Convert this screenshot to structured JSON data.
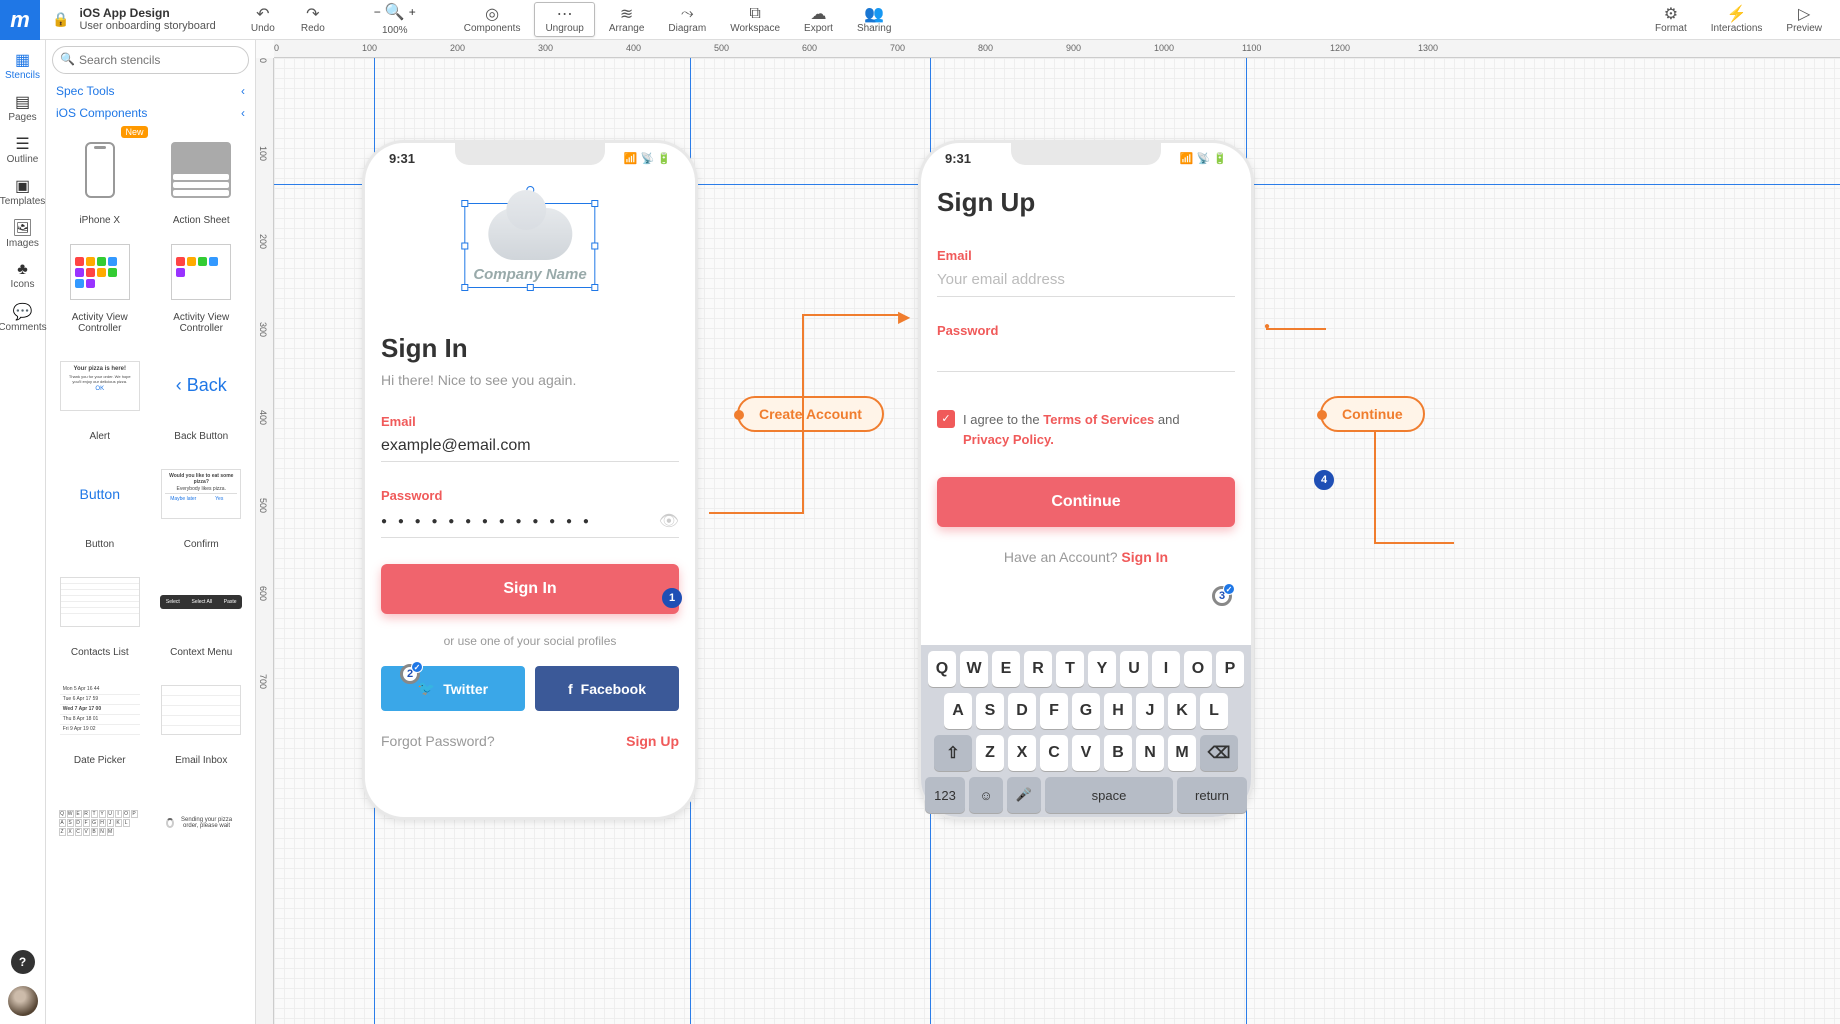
{
  "doc": {
    "title": "iOS App Design",
    "subtitle": "User onboarding storyboard"
  },
  "toolbar": {
    "undo": "Undo",
    "redo": "Redo",
    "zoom": "100%",
    "components": "Components",
    "ungroup": "Ungroup",
    "arrange": "Arrange",
    "diagram": "Diagram",
    "workspace": "Workspace",
    "export": "Export",
    "sharing": "Sharing",
    "format": "Format",
    "interactions": "Interactions",
    "preview": "Preview"
  },
  "leftrail": {
    "stencils": "Stencils",
    "pages": "Pages",
    "outline": "Outline",
    "templates": "Templates",
    "images": "Images",
    "icons": "Icons",
    "comments": "Comments"
  },
  "search": {
    "placeholder": "Search stencils"
  },
  "categories": {
    "spec": "Spec Tools",
    "ios": "iOS Components"
  },
  "stencils": [
    {
      "label": "iPhone X",
      "new": true
    },
    {
      "label": "Action Sheet"
    },
    {
      "label": "Activity View Controller"
    },
    {
      "label": "Activity View Controller"
    },
    {
      "label": "Alert",
      "alert_title": "Your pizza is here!",
      "alert_body": "Thank you for your order. We hope you'll enjoy our delicious pizza.",
      "alert_ok": "OK"
    },
    {
      "label": "Back Button",
      "text": "Back"
    },
    {
      "label": "Button",
      "text": "Button"
    },
    {
      "label": "Confirm",
      "q": "Would you like to eat some pizza?",
      "sub": "Everybody likes pizza.",
      "left": "Maybe later",
      "right": "Yes"
    },
    {
      "label": "Contacts List"
    },
    {
      "label": "Context Menu",
      "items": [
        "Select",
        "Select All",
        "Paste"
      ]
    },
    {
      "label": "Date Picker",
      "rows": [
        "Mon 5 Apr  16  44",
        "Tue 6 Apr  17  59",
        "Wed 7 Apr  17  00",
        "Thu 8 Apr  18  01",
        "Fri 9 Apr  19  02"
      ]
    },
    {
      "label": "Email Inbox"
    },
    {
      "label": "",
      "kb_rows": [
        "QWERTYUIOP",
        "ASDFGHJKL",
        "ZXCVBNM"
      ]
    },
    {
      "label": "",
      "spin": "Sending your pizza order, please wait"
    }
  ],
  "ruler": {
    "h": [
      "0",
      "100",
      "200",
      "300",
      "400",
      "500",
      "600",
      "700",
      "800",
      "900",
      "1000",
      "1100",
      "1200",
      "1300"
    ],
    "v": [
      "0",
      "100",
      "200",
      "300",
      "400",
      "500",
      "600",
      "700"
    ]
  },
  "screen1": {
    "time": "9:31",
    "company": "Company Name",
    "title": "Sign In",
    "hi": "Hi there! Nice to see you again.",
    "email_lbl": "Email",
    "email_val": "example@email.com",
    "pwd_lbl": "Password",
    "pwd_val": "● ● ● ● ● ● ● ● ● ● ● ● ●",
    "signin_btn": "Sign In",
    "social_hint": "or use one of your social profiles",
    "twitter": "Twitter",
    "facebook": "Facebook",
    "forgot": "Forgot Password?",
    "signup": "Sign Up"
  },
  "screen2": {
    "time": "9:31",
    "title": "Sign Up",
    "email_lbl": "Email",
    "email_ph": "Your email address",
    "pwd_lbl": "Password",
    "agree_pre": "I agree to the ",
    "tos": "Terms of Services",
    "agree_mid": " and ",
    "pp": "Privacy Policy.",
    "continue_btn": "Continue",
    "have_pre": "Have an Account?  ",
    "have_link": "Sign In",
    "kb_row1": [
      "Q",
      "W",
      "E",
      "R",
      "T",
      "Y",
      "U",
      "I",
      "O",
      "P"
    ],
    "kb_row2": [
      "A",
      "S",
      "D",
      "F",
      "G",
      "H",
      "J",
      "K",
      "L"
    ],
    "kb_row3": [
      "Z",
      "X",
      "C",
      "V",
      "B",
      "N",
      "M"
    ],
    "k123": "123",
    "kspace": "space",
    "kret": "return"
  },
  "annotations": {
    "badge1": "1",
    "badge2": "2",
    "badge3": "3",
    "badge4": "4",
    "create_account": "Create Account",
    "continue": "Continue"
  }
}
